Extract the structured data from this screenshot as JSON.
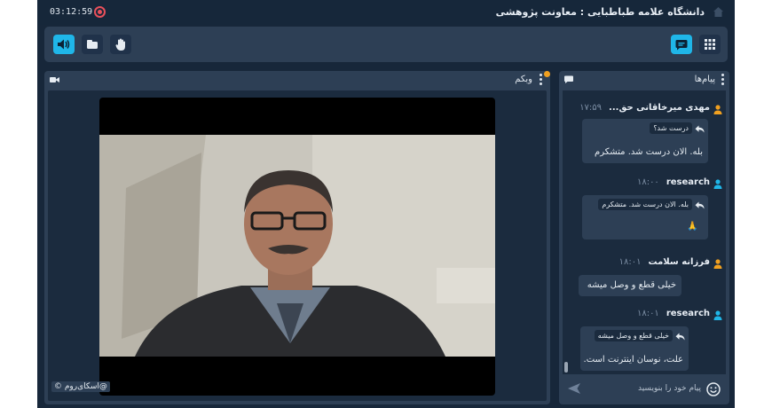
{
  "topbar": {
    "timer": "03:12:59",
    "title": "دانشگاه علامه طباطبایی : معاونت پژوهشی"
  },
  "webcam": {
    "title": "وبکم",
    "watermark": "@اسکای‌روم ©"
  },
  "chat": {
    "title": "پیام‌ها",
    "input_placeholder": "پیام خود را بنویسید",
    "messages": [
      {
        "sender": "مهدی میرخاقانی حق...",
        "time": "۱۷:۵۹",
        "reply_to": "درست شد؟",
        "text": "بله. الان درست شد. متشکرم"
      },
      {
        "sender": "research",
        "time": "۱۸:۰۰",
        "reply_to": "بله. الان درست شد. متشکرم",
        "text": "🙏"
      },
      {
        "sender": "فرزانه سلامت",
        "time": "۱۸:۰۱",
        "reply_to": "",
        "text": "خیلی قطع و وصل میشه"
      },
      {
        "sender": "research",
        "time": "۱۸:۰۱",
        "reply_to": "خیلی قطع و وصل میشه",
        "text": "علت، نوسان اینترنت است."
      }
    ]
  },
  "colors": {
    "accent": "#1fb6e8",
    "background": "#17273a",
    "panel": "#2d3f55",
    "record": "#e8505b",
    "user_icon": "#f0a020",
    "user_icon_alt": "#1fb6e8"
  },
  "icons": {
    "record": "record-icon",
    "home": "home-icon",
    "speaker": "speaker-icon",
    "board": "board-icon",
    "hand": "raise-hand-icon",
    "chat": "chat-icon",
    "grid": "grid-icon",
    "camera": "camera-icon",
    "send": "send-icon",
    "emoji": "emoji-icon"
  }
}
